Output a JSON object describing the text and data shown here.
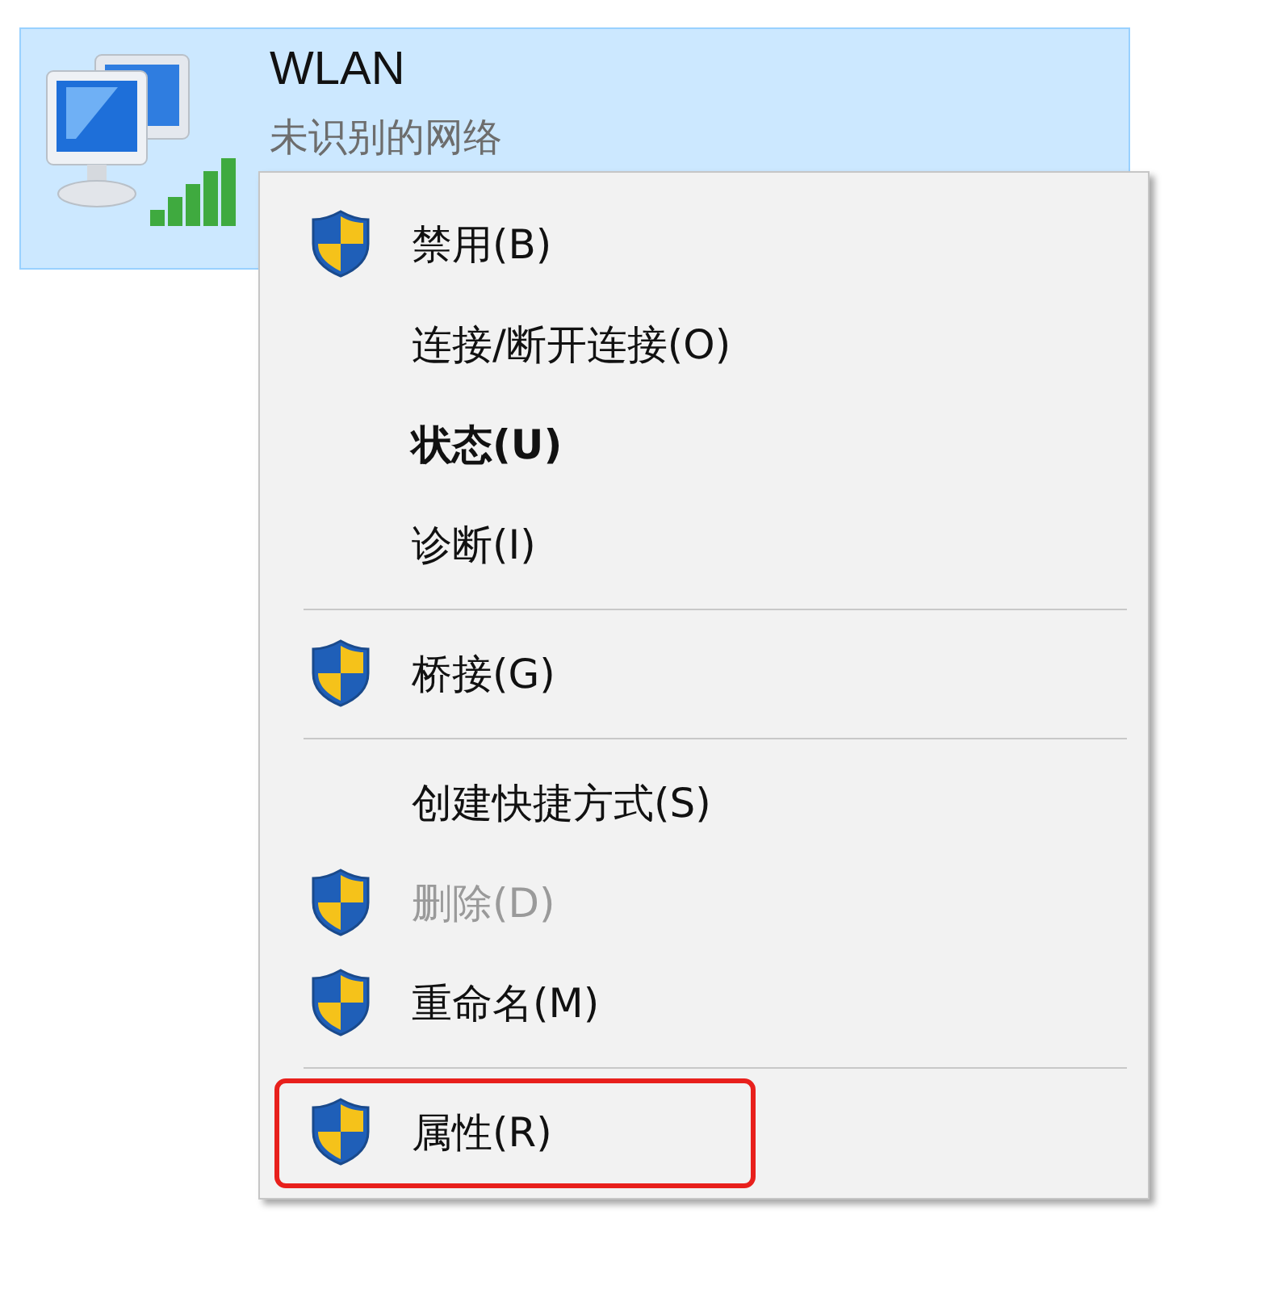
{
  "network": {
    "name": "WLAN",
    "status": "未识别的网络",
    "selected": true
  },
  "context_menu": {
    "items": [
      {
        "kind": "item",
        "label": "禁用(B)",
        "shield": true,
        "bold": false,
        "disabled": false,
        "highlighted": false
      },
      {
        "kind": "item",
        "label": "连接/断开连接(O)",
        "shield": false,
        "bold": false,
        "disabled": false,
        "highlighted": false
      },
      {
        "kind": "item",
        "label": "状态(U)",
        "shield": false,
        "bold": true,
        "disabled": false,
        "highlighted": false
      },
      {
        "kind": "item",
        "label": "诊断(I)",
        "shield": false,
        "bold": false,
        "disabled": false,
        "highlighted": false
      },
      {
        "kind": "separator"
      },
      {
        "kind": "item",
        "label": "桥接(G)",
        "shield": true,
        "bold": false,
        "disabled": false,
        "highlighted": false
      },
      {
        "kind": "separator"
      },
      {
        "kind": "item",
        "label": "创建快捷方式(S)",
        "shield": false,
        "bold": false,
        "disabled": false,
        "highlighted": false
      },
      {
        "kind": "item",
        "label": "删除(D)",
        "shield": true,
        "bold": false,
        "disabled": true,
        "highlighted": false
      },
      {
        "kind": "item",
        "label": "重命名(M)",
        "shield": true,
        "bold": false,
        "disabled": false,
        "highlighted": false
      },
      {
        "kind": "separator"
      },
      {
        "kind": "item",
        "label": "属性(R)",
        "shield": true,
        "bold": false,
        "disabled": false,
        "highlighted": true
      }
    ]
  }
}
